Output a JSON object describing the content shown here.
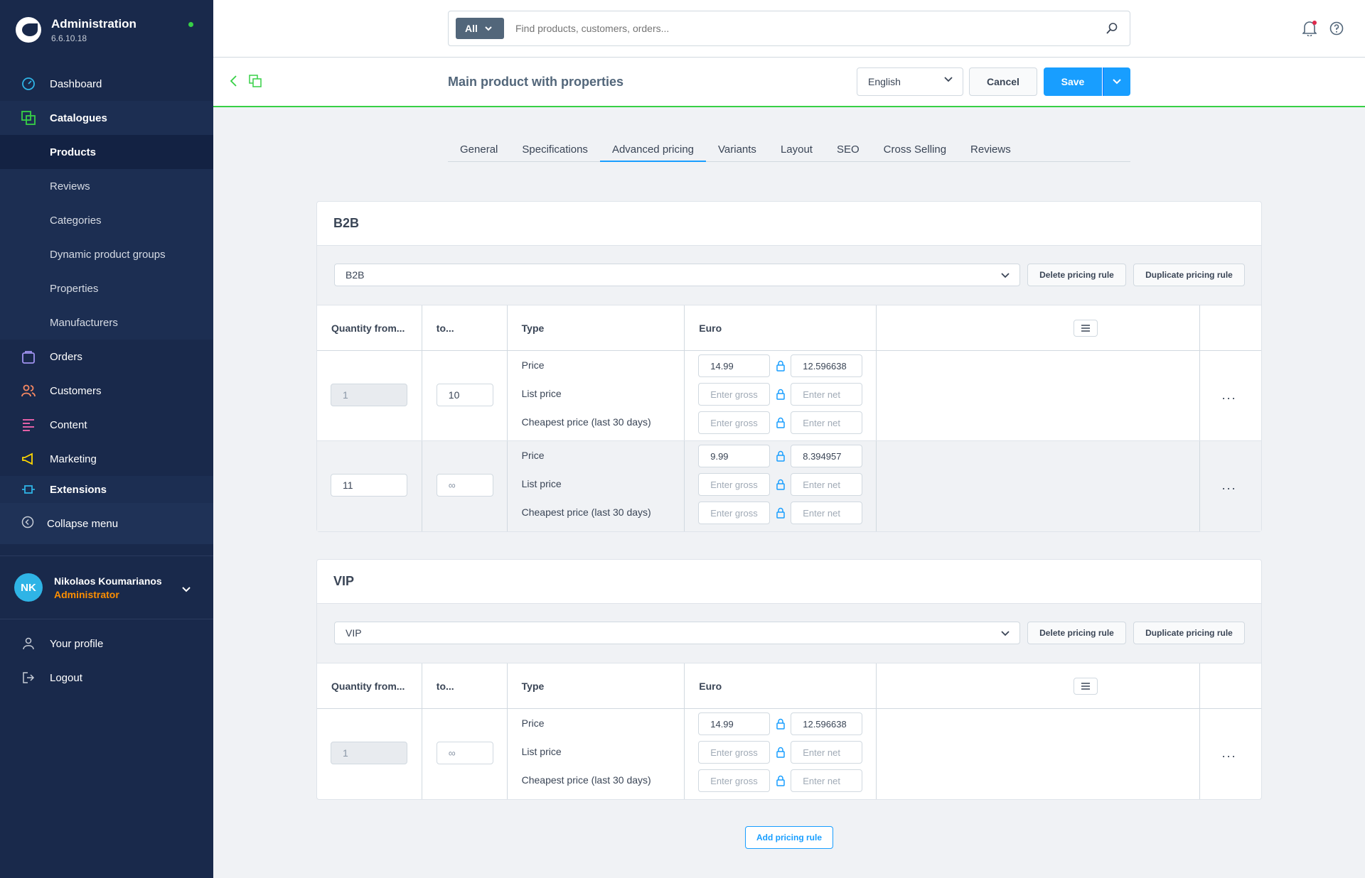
{
  "app": {
    "title": "Administration",
    "version": "6.6.10.18"
  },
  "nav": {
    "dashboard": "Dashboard",
    "catalogues": "Catalogues",
    "sub": [
      "Products",
      "Reviews",
      "Categories",
      "Dynamic product groups",
      "Properties",
      "Manufacturers"
    ],
    "orders": "Orders",
    "customers": "Customers",
    "content": "Content",
    "marketing": "Marketing",
    "extensions": "Extensions",
    "collapse": "Collapse menu"
  },
  "user": {
    "initials": "NK",
    "name": "Nikolaos Koumarianos",
    "role": "Administrator"
  },
  "footer": {
    "profile": "Your profile",
    "logout": "Logout"
  },
  "search": {
    "scope": "All",
    "placeholder": "Find products, customers, orders..."
  },
  "smartbar": {
    "title": "Main product with properties",
    "language": "English",
    "cancel": "Cancel",
    "save": "Save"
  },
  "tabs": [
    "General",
    "Specifications",
    "Advanced pricing",
    "Variants",
    "Layout",
    "SEO",
    "Cross Selling",
    "Reviews"
  ],
  "columns": {
    "qty_from": "Quantity from...",
    "qty_to": "to...",
    "type": "Type",
    "currency": "Euro"
  },
  "price_types": {
    "price": "Price",
    "list": "List price",
    "cheapest": "Cheapest price (last 30 days)"
  },
  "placeholders": {
    "gross": "Enter gross",
    "net": "Enter net"
  },
  "buttons": {
    "delete": "Delete pricing rule",
    "duplicate": "Duplicate pricing rule",
    "add": "Add pricing rule",
    "more": "···"
  },
  "b2b": {
    "title": "B2B",
    "rule": "B2B",
    "rows": [
      {
        "from": "1",
        "to": "10",
        "gross": "14.99",
        "net": "12.596638"
      },
      {
        "from": "11",
        "to": "∞",
        "gross": "9.99",
        "net": "8.394957"
      }
    ]
  },
  "vip": {
    "title": "VIP",
    "rule": "VIP",
    "rows": [
      {
        "from": "1",
        "to": "∞",
        "gross": "14.99",
        "net": "12.596638"
      }
    ]
  },
  "colors": {
    "sidebar": "#19294b",
    "accent": "#189eff",
    "success": "#37d046",
    "role": "#ff8f00"
  }
}
